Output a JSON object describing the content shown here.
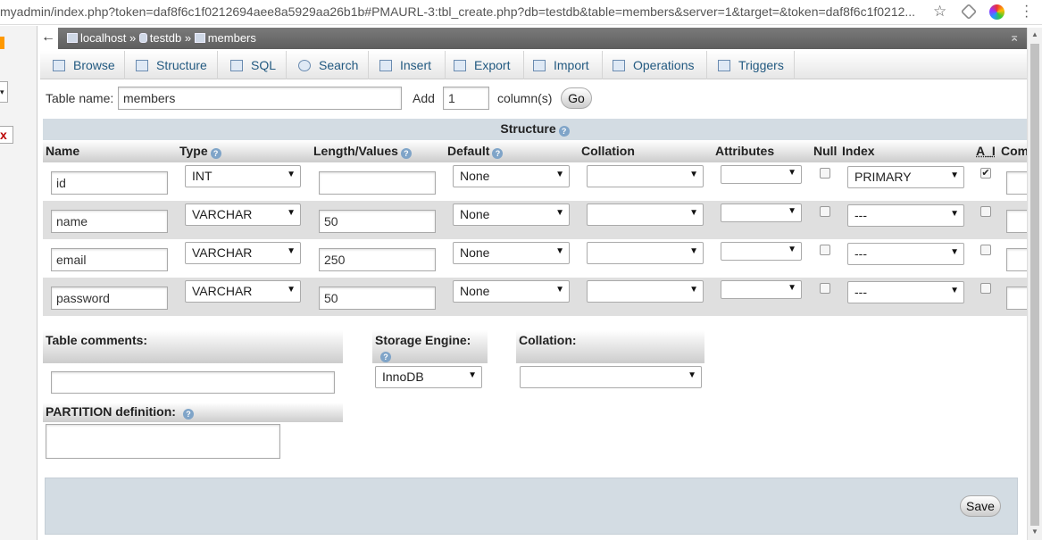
{
  "browser": {
    "url": "myadmin/index.php?token=daf8f6c1f0212694aee8a5929aa26b1b#PMAURL-3:tbl_create.php?db=testdb&table=members&server=1&target=&token=daf8f6c1f0212..."
  },
  "breadcrumb": {
    "server": "localhost",
    "sep1": "»",
    "database": "testdb",
    "sep2": "»",
    "table": "members"
  },
  "tabs": [
    "Browse",
    "Structure",
    "SQL",
    "Search",
    "Insert",
    "Export",
    "Import",
    "Operations",
    "Triggers"
  ],
  "table_name": {
    "label": "Table name:",
    "value": "members"
  },
  "add": {
    "label": "Add",
    "value": "1",
    "suffix": "column(s)",
    "go": "Go"
  },
  "structure_title": "Structure",
  "columns": [
    "Name",
    "Type",
    "Length/Values",
    "Default",
    "Collation",
    "Attributes",
    "Null",
    "Index",
    "A_I",
    "Com"
  ],
  "rows": [
    {
      "name": "id",
      "type": "INT",
      "length": "",
      "default": "None",
      "collation": "",
      "attributes": "",
      "null": false,
      "index": "PRIMARY",
      "ai": true
    },
    {
      "name": "name",
      "type": "VARCHAR",
      "length": "50",
      "default": "None",
      "collation": "",
      "attributes": "",
      "null": false,
      "index": "---",
      "ai": false
    },
    {
      "name": "email",
      "type": "VARCHAR",
      "length": "250",
      "default": "None",
      "collation": "",
      "attributes": "",
      "null": false,
      "index": "---",
      "ai": false
    },
    {
      "name": "password",
      "type": "VARCHAR",
      "length": "50",
      "default": "None",
      "collation": "",
      "attributes": "",
      "null": false,
      "index": "---",
      "ai": false
    }
  ],
  "table_comments": {
    "label": "Table comments:",
    "value": ""
  },
  "storage_engine": {
    "label": "Storage Engine:",
    "value": "InnoDB"
  },
  "collation": {
    "label": "Collation:",
    "value": ""
  },
  "partition": {
    "label": "PARTITION definition:",
    "value": ""
  },
  "save": "Save",
  "icons": {
    "back": "back-arrow-icon",
    "help": "help-icon",
    "star": "bookmark-star-icon"
  }
}
